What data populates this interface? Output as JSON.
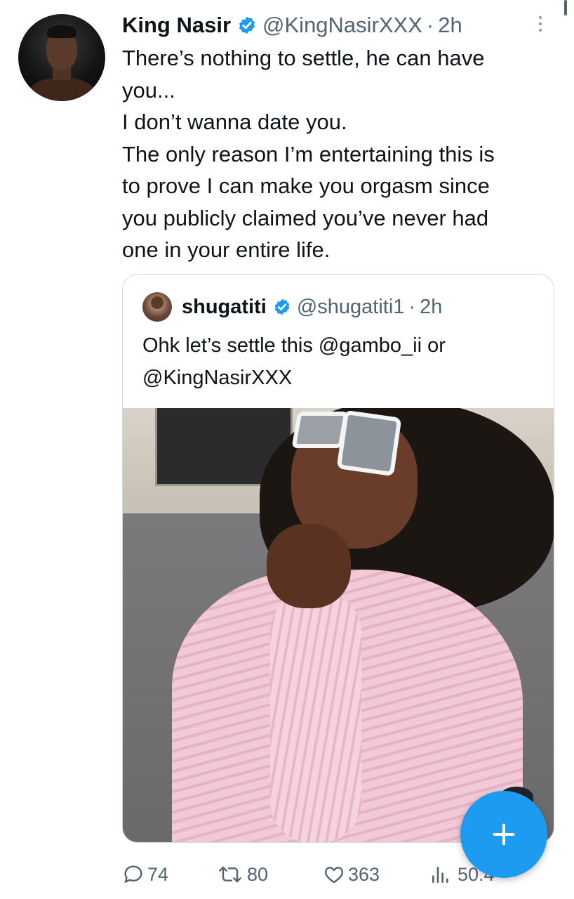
{
  "tweet": {
    "author": {
      "name": "King Nasir",
      "handle": "@KingNasirXXX",
      "time": "2h",
      "separator": "·"
    },
    "text_lines": [
      "There’s nothing to settle, he can have",
      "you...",
      "I don’t wanna date you.",
      "The only reason I’m entertaining this is",
      "to prove I can make you orgasm since",
      "you publicly claimed you’ve never had",
      "one in your entire life."
    ],
    "quoted": {
      "name": "shugatiti",
      "handle": "@shugatiti1",
      "time": "2h",
      "separator": "·",
      "text_lines": [
        "Ohk let’s settle this @gambo_ii or",
        "@KingNasirXXX"
      ]
    },
    "actions": {
      "replies": "74",
      "retweets": "80",
      "likes": "363",
      "views": "50.4"
    }
  },
  "icons": {
    "verified": "verified-badge-icon",
    "more": "more-vertical-icon",
    "reply": "reply-icon",
    "retweet": "retweet-icon",
    "like": "heart-icon",
    "views": "views-icon",
    "compose": "plus-icon"
  },
  "colors": {
    "accent": "#1d9bf0",
    "text": "#0f1419",
    "secondary": "#536471",
    "border": "#cfd9de"
  }
}
